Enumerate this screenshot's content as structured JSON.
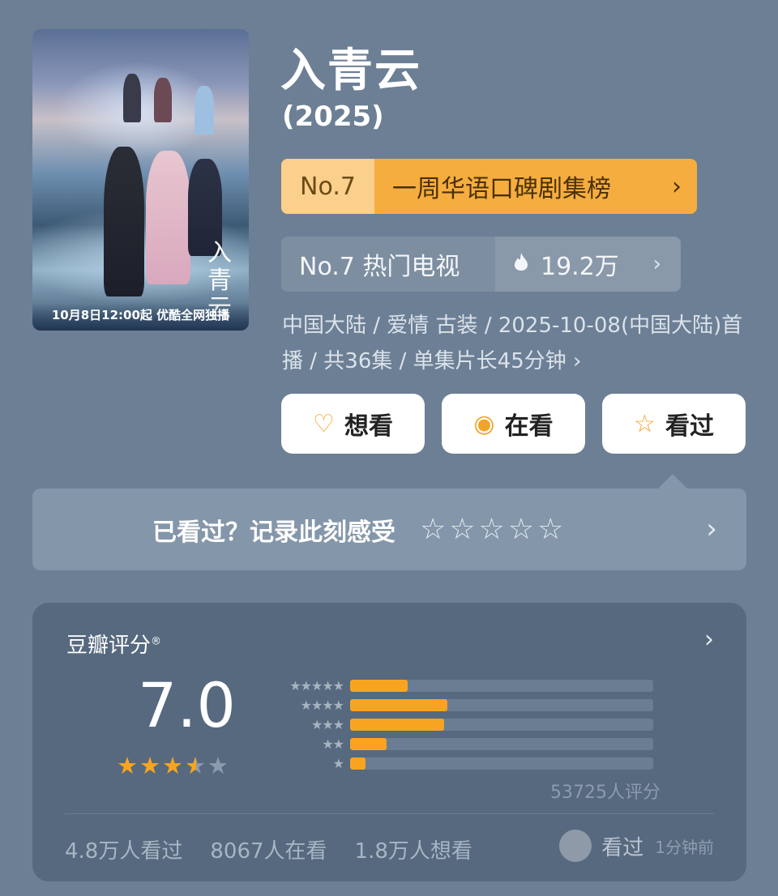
{
  "poster": {
    "calligraphy": "入青云",
    "banner": "10月8日12:00起 优酷全网独播"
  },
  "show": {
    "title": "入青云",
    "year": "(2025)"
  },
  "rank_primary": {
    "no": "No.7",
    "label": "一周华语口碑剧集榜",
    "chevron": "›"
  },
  "rank_secondary": {
    "label": "No.7 热门电视",
    "heat": "19.2万",
    "chevron": "›"
  },
  "meta": {
    "text": "中国大陆 / 爱情 古装 / 2025-10-08(中国大陆)首播 / 共36集 / 单集片长45分钟 ›"
  },
  "actions": [
    {
      "label": "想看",
      "icon": "heart-plus-icon",
      "glyph": "♡"
    },
    {
      "label": "在看",
      "icon": "target-icon",
      "glyph": "◉"
    },
    {
      "label": "看过",
      "icon": "star-outline-icon",
      "glyph": "☆"
    }
  ],
  "rate_prompt": {
    "text": "已看过？记录此刻感受",
    "stars": "☆☆☆☆☆",
    "chevron": "›"
  },
  "douban": {
    "title": "豆瓣评分",
    "mark": "®",
    "chevron": "›",
    "score": "7.0",
    "stars_value": 3.5,
    "stars_filled": "★★★",
    "stars_half": "★",
    "stars_empty": "★",
    "distribution": [
      {
        "label": "★★★★★",
        "fraction": 0.19
      },
      {
        "label": "★★★★",
        "fraction": 0.32
      },
      {
        "label": "★★★",
        "fraction": 0.31
      },
      {
        "label": "★★",
        "fraction": 0.12
      },
      {
        "label": "★",
        "fraction": 0.05
      }
    ],
    "rating_count": "53725人评分",
    "stats": [
      "4.8万人看过",
      "8067人在看",
      "1.8万人想看"
    ],
    "activity": {
      "status": "看过",
      "time": "1分钟前"
    }
  },
  "colors": {
    "background": "#6c7f95",
    "accent": "#f7a521",
    "rank_highlight": "#fbd08c"
  }
}
